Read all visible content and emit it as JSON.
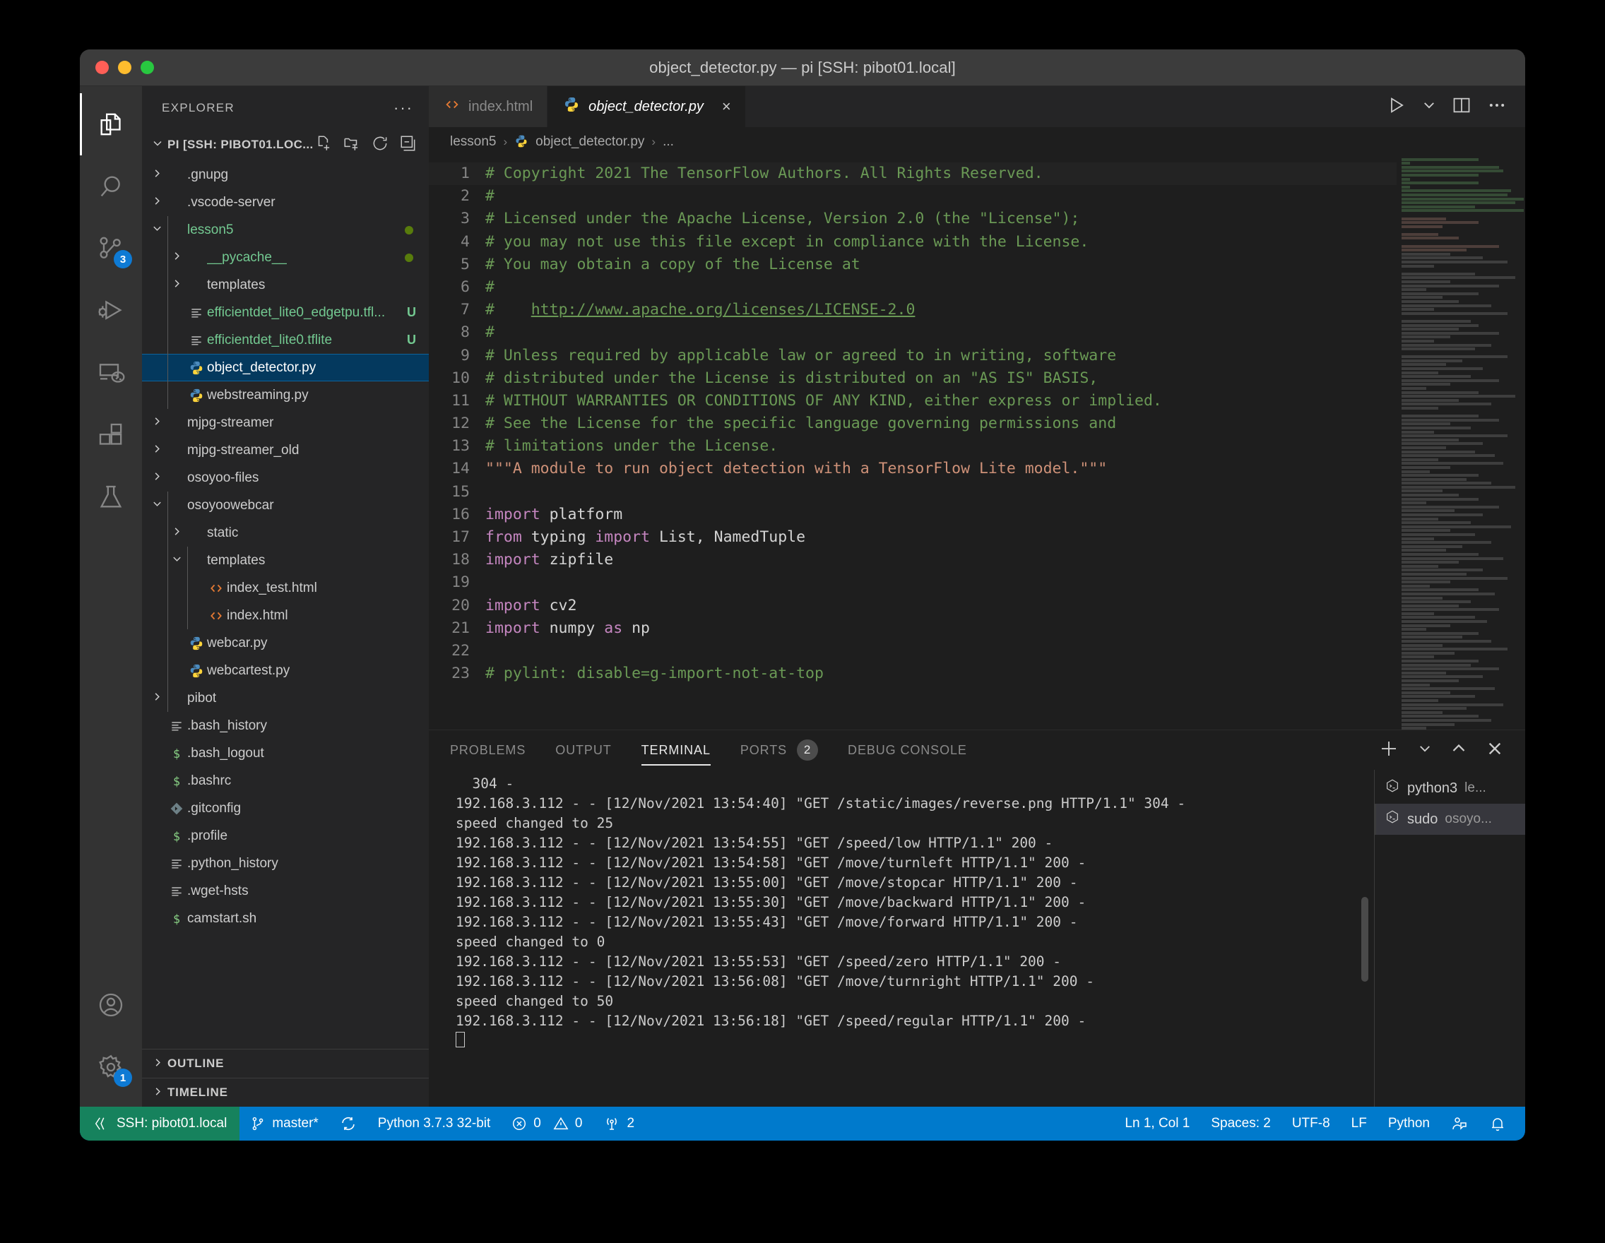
{
  "window": {
    "title": "object_detector.py — pi [SSH: pibot01.local]",
    "traffic_lights": [
      "close",
      "minimize",
      "maximize"
    ]
  },
  "activity_bar": {
    "items": [
      {
        "name": "explorer",
        "icon": "files-icon",
        "active": true,
        "badge": ""
      },
      {
        "name": "search",
        "icon": "search-icon",
        "active": false,
        "badge": ""
      },
      {
        "name": "source-control",
        "icon": "source-control-icon",
        "active": false,
        "badge": "3"
      },
      {
        "name": "run-and-debug",
        "icon": "debug-icon",
        "active": false,
        "badge": ""
      },
      {
        "name": "remote-explorer",
        "icon": "remote-explorer-icon",
        "active": false,
        "badge": ""
      },
      {
        "name": "extensions",
        "icon": "extensions-icon",
        "active": false,
        "badge": ""
      },
      {
        "name": "testing",
        "icon": "beaker-icon",
        "active": false,
        "badge": ""
      }
    ],
    "bottom_items": [
      {
        "name": "accounts",
        "icon": "account-icon",
        "badge": ""
      },
      {
        "name": "manage",
        "icon": "gear-icon",
        "badge": "1"
      }
    ]
  },
  "sidebar": {
    "title": "EXPLORER",
    "more_actions": "···",
    "root_label": "PI [SSH: PIBOT01.LOC...",
    "root_actions": [
      "new-file",
      "new-folder",
      "refresh",
      "collapse-all"
    ],
    "tree": [
      {
        "label": ".gnupg",
        "type": "folder",
        "depth": 1,
        "expanded": false,
        "icon": "chevron-right",
        "badge": "",
        "color": "normal"
      },
      {
        "label": ".vscode-server",
        "type": "folder",
        "depth": 1,
        "expanded": false,
        "icon": "chevron-right",
        "badge": "",
        "color": "normal"
      },
      {
        "label": "lesson5",
        "type": "folder",
        "depth": 1,
        "expanded": true,
        "icon": "chevron-down",
        "badge": "dot",
        "color": "green"
      },
      {
        "label": "__pycache__",
        "type": "folder",
        "depth": 2,
        "expanded": false,
        "icon": "chevron-right",
        "badge": "dot",
        "color": "green"
      },
      {
        "label": "templates",
        "type": "folder",
        "depth": 2,
        "expanded": false,
        "icon": "chevron-right",
        "badge": "",
        "color": "normal"
      },
      {
        "label": "efficientdet_lite0_edgetpu.tfl...",
        "type": "file",
        "depth": 2,
        "expanded": false,
        "icon": "text-file-icon",
        "badge": "U",
        "color": "green"
      },
      {
        "label": "efficientdet_lite0.tflite",
        "type": "file",
        "depth": 2,
        "expanded": false,
        "icon": "text-file-icon",
        "badge": "U",
        "color": "green"
      },
      {
        "label": "object_detector.py",
        "type": "file",
        "depth": 2,
        "expanded": false,
        "icon": "python-icon",
        "badge": "",
        "color": "normal",
        "selected": true
      },
      {
        "label": "webstreaming.py",
        "type": "file",
        "depth": 2,
        "expanded": false,
        "icon": "python-icon",
        "badge": "",
        "color": "normal"
      },
      {
        "label": "mjpg-streamer",
        "type": "folder",
        "depth": 1,
        "expanded": false,
        "icon": "chevron-right",
        "badge": "",
        "color": "normal"
      },
      {
        "label": "mjpg-streamer_old",
        "type": "folder",
        "depth": 1,
        "expanded": false,
        "icon": "chevron-right",
        "badge": "",
        "color": "normal"
      },
      {
        "label": "osoyoo-files",
        "type": "folder",
        "depth": 1,
        "expanded": false,
        "icon": "chevron-right",
        "badge": "",
        "color": "normal"
      },
      {
        "label": "osoyoowebcar",
        "type": "folder",
        "depth": 1,
        "expanded": true,
        "icon": "chevron-down",
        "badge": "",
        "color": "normal"
      },
      {
        "label": "static",
        "type": "folder",
        "depth": 2,
        "expanded": false,
        "icon": "chevron-right",
        "badge": "",
        "color": "normal"
      },
      {
        "label": "templates",
        "type": "folder",
        "depth": 2,
        "expanded": true,
        "icon": "chevron-down",
        "badge": "",
        "color": "normal"
      },
      {
        "label": "index_test.html",
        "type": "file",
        "depth": 3,
        "expanded": false,
        "icon": "html-icon",
        "badge": "",
        "color": "normal"
      },
      {
        "label": "index.html",
        "type": "file",
        "depth": 3,
        "expanded": false,
        "icon": "html-icon",
        "badge": "",
        "color": "normal"
      },
      {
        "label": "webcar.py",
        "type": "file",
        "depth": 2,
        "expanded": false,
        "icon": "python-icon",
        "badge": "",
        "color": "normal"
      },
      {
        "label": "webcartest.py",
        "type": "file",
        "depth": 2,
        "expanded": false,
        "icon": "python-icon",
        "badge": "",
        "color": "normal"
      },
      {
        "label": "pibot",
        "type": "folder",
        "depth": 1,
        "expanded": false,
        "icon": "chevron-right",
        "badge": "",
        "color": "normal"
      },
      {
        "label": ".bash_history",
        "type": "file",
        "depth": 1,
        "expanded": false,
        "icon": "text-file-icon",
        "badge": "",
        "color": "normal"
      },
      {
        "label": ".bash_logout",
        "type": "file",
        "depth": 1,
        "expanded": false,
        "icon": "shell-icon",
        "badge": "",
        "color": "normal"
      },
      {
        "label": ".bashrc",
        "type": "file",
        "depth": 1,
        "expanded": false,
        "icon": "shell-icon",
        "badge": "",
        "color": "normal"
      },
      {
        "label": ".gitconfig",
        "type": "file",
        "depth": 1,
        "expanded": false,
        "icon": "git-icon",
        "badge": "",
        "color": "normal"
      },
      {
        "label": ".profile",
        "type": "file",
        "depth": 1,
        "expanded": false,
        "icon": "shell-icon",
        "badge": "",
        "color": "normal"
      },
      {
        "label": ".python_history",
        "type": "file",
        "depth": 1,
        "expanded": false,
        "icon": "text-file-icon",
        "badge": "",
        "color": "normal"
      },
      {
        "label": ".wget-hsts",
        "type": "file",
        "depth": 1,
        "expanded": false,
        "icon": "text-file-icon",
        "badge": "",
        "color": "normal"
      },
      {
        "label": "camstart.sh",
        "type": "file",
        "depth": 1,
        "expanded": false,
        "icon": "shell-icon",
        "badge": "",
        "color": "normal"
      }
    ],
    "sections": [
      {
        "label": "OUTLINE",
        "expanded": false
      },
      {
        "label": "TIMELINE",
        "expanded": false
      }
    ]
  },
  "editor": {
    "tabs": [
      {
        "label": "index.html",
        "icon": "html-icon",
        "active": false,
        "closable": false
      },
      {
        "label": "object_detector.py",
        "icon": "python-icon",
        "active": true,
        "closable": true,
        "close_glyph": "×"
      }
    ],
    "tab_actions": [
      "run-icon",
      "chevron-down-icon",
      "split-editor-icon",
      "more-actions-icon"
    ],
    "breadcrumb": [
      {
        "label": "lesson5",
        "icon": ""
      },
      {
        "label": "object_detector.py",
        "icon": "python-icon"
      },
      {
        "label": "...",
        "icon": ""
      }
    ],
    "breadcrumb_separator": "›",
    "first_line": 1,
    "lines": [
      {
        "n": 1,
        "tokens": [
          {
            "t": "# Copyright 2021 The TensorFlow Authors. All Rights Reserved.",
            "c": "com"
          }
        ],
        "current": true
      },
      {
        "n": 2,
        "tokens": [
          {
            "t": "#",
            "c": "com"
          }
        ]
      },
      {
        "n": 3,
        "tokens": [
          {
            "t": "# Licensed under the Apache License, Version 2.0 (the \"License\");",
            "c": "com"
          }
        ]
      },
      {
        "n": 4,
        "tokens": [
          {
            "t": "# you may not use this file except in compliance with the License.",
            "c": "com"
          }
        ]
      },
      {
        "n": 5,
        "tokens": [
          {
            "t": "# You may obtain a copy of the License at",
            "c": "com"
          }
        ]
      },
      {
        "n": 6,
        "tokens": [
          {
            "t": "#",
            "c": "com"
          }
        ]
      },
      {
        "n": 7,
        "tokens": [
          {
            "t": "#    ",
            "c": "com"
          },
          {
            "t": "http://www.apache.org/licenses/LICENSE-2.0",
            "c": "link"
          }
        ]
      },
      {
        "n": 8,
        "tokens": [
          {
            "t": "#",
            "c": "com"
          }
        ]
      },
      {
        "n": 9,
        "tokens": [
          {
            "t": "# Unless required by applicable law or agreed to in writing, software",
            "c": "com"
          }
        ]
      },
      {
        "n": 10,
        "tokens": [
          {
            "t": "# distributed under the License is distributed on an \"AS IS\" BASIS,",
            "c": "com"
          }
        ]
      },
      {
        "n": 11,
        "tokens": [
          {
            "t": "# WITHOUT WARRANTIES OR CONDITIONS OF ANY KIND, either express or implied.",
            "c": "com"
          }
        ]
      },
      {
        "n": 12,
        "tokens": [
          {
            "t": "# See the License for the specific language governing permissions and",
            "c": "com"
          }
        ]
      },
      {
        "n": 13,
        "tokens": [
          {
            "t": "# limitations under the License.",
            "c": "com"
          }
        ]
      },
      {
        "n": 14,
        "tokens": [
          {
            "t": "\"\"\"A module to run object detection with a TensorFlow Lite model.\"\"\"",
            "c": "str"
          }
        ]
      },
      {
        "n": 15,
        "tokens": [
          {
            "t": "",
            "c": "id"
          }
        ]
      },
      {
        "n": 16,
        "tokens": [
          {
            "t": "import",
            "c": "kw"
          },
          {
            "t": " platform",
            "c": "id"
          }
        ]
      },
      {
        "n": 17,
        "tokens": [
          {
            "t": "from",
            "c": "kw"
          },
          {
            "t": " typing ",
            "c": "id"
          },
          {
            "t": "import",
            "c": "kw"
          },
          {
            "t": " List, NamedTuple",
            "c": "id"
          }
        ]
      },
      {
        "n": 18,
        "tokens": [
          {
            "t": "import",
            "c": "kw"
          },
          {
            "t": " zipfile",
            "c": "id"
          }
        ]
      },
      {
        "n": 19,
        "tokens": [
          {
            "t": "",
            "c": "id"
          }
        ]
      },
      {
        "n": 20,
        "tokens": [
          {
            "t": "import",
            "c": "kw"
          },
          {
            "t": " cv2",
            "c": "id"
          }
        ]
      },
      {
        "n": 21,
        "tokens": [
          {
            "t": "import",
            "c": "kw"
          },
          {
            "t": " numpy ",
            "c": "id"
          },
          {
            "t": "as",
            "c": "kw"
          },
          {
            "t": " np",
            "c": "id"
          }
        ]
      },
      {
        "n": 22,
        "tokens": [
          {
            "t": "",
            "c": "id"
          }
        ]
      },
      {
        "n": 23,
        "tokens": [
          {
            "t": "# pylint: disable=g-import-not-at-top",
            "c": "com"
          }
        ]
      }
    ]
  },
  "panel": {
    "tabs": [
      {
        "label": "PROBLEMS",
        "active": false,
        "badge": ""
      },
      {
        "label": "OUTPUT",
        "active": false,
        "badge": ""
      },
      {
        "label": "TERMINAL",
        "active": true,
        "badge": ""
      },
      {
        "label": "PORTS",
        "active": false,
        "badge": "2"
      },
      {
        "label": "DEBUG CONSOLE",
        "active": false,
        "badge": ""
      }
    ],
    "actions": [
      "new-terminal-icon",
      "chevron-down-icon",
      "maximize-panel-icon",
      "close-panel-icon"
    ],
    "terminal_output": "  304 -\n192.168.3.112 - - [12/Nov/2021 13:54:40] \"GET /static/images/reverse.png HTTP/1.1\" 304 -\nspeed changed to 25\n192.168.3.112 - - [12/Nov/2021 13:54:55] \"GET /speed/low HTTP/1.1\" 200 -\n192.168.3.112 - - [12/Nov/2021 13:54:58] \"GET /move/turnleft HTTP/1.1\" 200 -\n192.168.3.112 - - [12/Nov/2021 13:55:00] \"GET /move/stopcar HTTP/1.1\" 200 -\n192.168.3.112 - - [12/Nov/2021 13:55:30] \"GET /move/backward HTTP/1.1\" 200 -\n192.168.3.112 - - [12/Nov/2021 13:55:43] \"GET /move/forward HTTP/1.1\" 200 -\nspeed changed to 0\n192.168.3.112 - - [12/Nov/2021 13:55:53] \"GET /speed/zero HTTP/1.1\" 200 -\n192.168.3.112 - - [12/Nov/2021 13:56:08] \"GET /move/turnright HTTP/1.1\" 200 -\nspeed changed to 50\n192.168.3.112 - - [12/Nov/2021 13:56:18] \"GET /speed/regular HTTP/1.1\" 200 -\n",
    "terminal_list": [
      {
        "name": "python3",
        "detail": "le...",
        "icon": "terminal-icon",
        "active": false
      },
      {
        "name": "sudo",
        "detail": "osoyo...",
        "icon": "terminal-icon",
        "active": true
      }
    ]
  },
  "status_bar": {
    "remote": "SSH: pibot01.local",
    "branch": "master*",
    "sync_icon": "sync-icon",
    "interpreter": "Python 3.7.3 32-bit",
    "errors": "0",
    "warnings": "0",
    "ports_count": "2",
    "cursor": "Ln 1, Col 1",
    "indentation": "Spaces: 2",
    "encoding": "UTF-8",
    "eol": "LF",
    "language": "Python",
    "feedback_icon": "feedback-icon",
    "bell_icon": "bell-icon"
  },
  "colors": {
    "accent_blue": "#007acc",
    "remote_green": "#16825d",
    "selection_blue": "#04395e",
    "badge_blue": "#0e7ad4",
    "comment_green": "#6a9955",
    "string_orange": "#ce9178",
    "keyword_purple": "#c586c0",
    "git_green": "#73c991"
  }
}
